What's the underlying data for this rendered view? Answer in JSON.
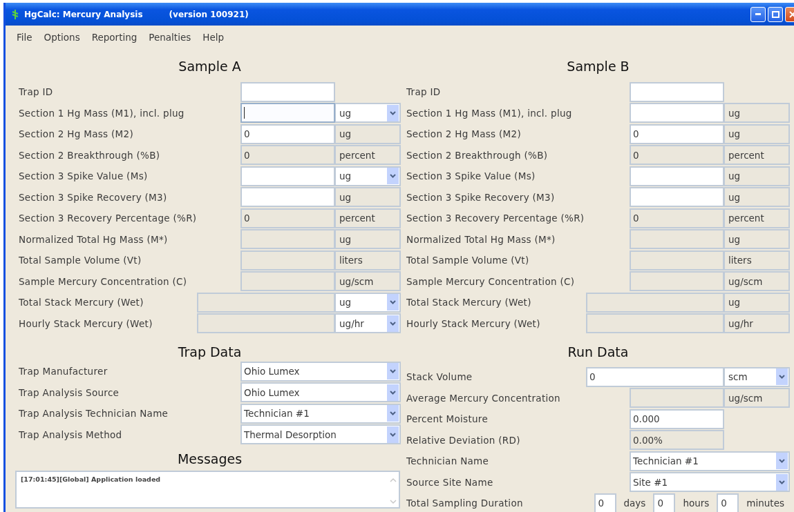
{
  "window": {
    "title": "HgCalc: Mercury Analysis",
    "version": "(version 100921)"
  },
  "menu": [
    "File",
    "Options",
    "Reporting",
    "Penalties",
    "Help"
  ],
  "samples": [
    {
      "heading": "Sample A",
      "rows": [
        {
          "kind": "normal",
          "label": "Trap ID",
          "editable": true,
          "focused": false
        },
        {
          "kind": "normal",
          "label": "Section 1 Hg Mass (M1), incl. plug",
          "editable": true,
          "focused": true,
          "unit": {
            "text": "ug",
            "dropdown": true
          }
        },
        {
          "kind": "normal",
          "label": "Section 2 Hg Mass (M2)",
          "value": "0",
          "editable": true,
          "focused": false,
          "unit": {
            "text": "ug",
            "dropdown": false
          }
        },
        {
          "kind": "normal",
          "label": "Section 2 Breakthrough (%B)",
          "value": "0",
          "editable": false,
          "focused": false,
          "unit": {
            "text": "percent",
            "dropdown": false
          }
        },
        {
          "kind": "normal",
          "label": "Section 3 Spike Value (Ms)",
          "editable": true,
          "focused": false,
          "unit": {
            "text": "ug",
            "dropdown": true
          }
        },
        {
          "kind": "normal",
          "label": "Section 3 Spike Recovery (M3)",
          "editable": true,
          "focused": false,
          "unit": {
            "text": "ug",
            "dropdown": false
          }
        },
        {
          "kind": "normal",
          "label": "Section 3 Recovery Percentage (%R)",
          "value": "0",
          "editable": false,
          "focused": false,
          "unit": {
            "text": "percent",
            "dropdown": false
          }
        },
        {
          "kind": "normal",
          "label": "Normalized Total Hg Mass (M*)",
          "editable": false,
          "focused": false,
          "unit": {
            "text": "ug",
            "dropdown": false
          }
        },
        {
          "kind": "normal",
          "label": "Total Sample Volume (Vt)",
          "editable": false,
          "focused": false,
          "unit": {
            "text": "liters",
            "dropdown": false
          }
        },
        {
          "kind": "normal",
          "label": "Sample Mercury Concentration (C)",
          "editable": false,
          "focused": false,
          "unit": {
            "text": "ug/scm",
            "dropdown": false
          }
        },
        {
          "kind": "wide",
          "label": "Total Stack Mercury (Wet)",
          "editable": false,
          "focused": false,
          "unit": {
            "text": "ug",
            "dropdown": true
          }
        },
        {
          "kind": "wide",
          "label": "Hourly Stack Mercury (Wet)",
          "editable": false,
          "focused": false,
          "unit": {
            "text": "ug/hr",
            "dropdown": true
          }
        }
      ]
    },
    {
      "heading": "Sample B",
      "rows": [
        {
          "kind": "normal",
          "label": "Trap ID",
          "editable": true,
          "focused": false
        },
        {
          "kind": "normal",
          "label": "Section 1 Hg Mass (M1), incl. plug",
          "editable": true,
          "focused": false,
          "unit": {
            "text": "ug",
            "dropdown": false
          }
        },
        {
          "kind": "normal",
          "label": "Section 2 Hg Mass (M2)",
          "value": "0",
          "editable": true,
          "focused": false,
          "unit": {
            "text": "ug",
            "dropdown": false
          }
        },
        {
          "kind": "normal",
          "label": "Section 2 Breakthrough (%B)",
          "value": "0",
          "editable": false,
          "focused": false,
          "unit": {
            "text": "percent",
            "dropdown": false
          }
        },
        {
          "kind": "normal",
          "label": "Section 3 Spike Value (Ms)",
          "editable": true,
          "focused": false,
          "unit": {
            "text": "ug",
            "dropdown": false
          }
        },
        {
          "kind": "normal",
          "label": "Section 3 Spike Recovery (M3)",
          "editable": true,
          "focused": false,
          "unit": {
            "text": "ug",
            "dropdown": false
          }
        },
        {
          "kind": "normal",
          "label": "Section 3 Recovery Percentage (%R)",
          "value": "0",
          "editable": false,
          "focused": false,
          "unit": {
            "text": "percent",
            "dropdown": false
          }
        },
        {
          "kind": "normal",
          "label": "Normalized Total Hg Mass (M*)",
          "editable": false,
          "focused": false,
          "unit": {
            "text": "ug",
            "dropdown": false
          }
        },
        {
          "kind": "normal",
          "label": "Total Sample Volume (Vt)",
          "editable": false,
          "focused": false,
          "unit": {
            "text": "liters",
            "dropdown": false
          }
        },
        {
          "kind": "normal",
          "label": "Sample Mercury Concentration (C)",
          "editable": false,
          "focused": false,
          "unit": {
            "text": "ug/scm",
            "dropdown": false
          }
        },
        {
          "kind": "wide",
          "label": "Total Stack Mercury (Wet)",
          "editable": false,
          "focused": false,
          "unit": {
            "text": "ug",
            "dropdown": false
          }
        },
        {
          "kind": "wide",
          "label": "Hourly Stack Mercury (Wet)",
          "editable": false,
          "focused": false,
          "unit": {
            "text": "ug/hr",
            "dropdown": false
          }
        }
      ]
    }
  ],
  "trap_data": {
    "heading": "Trap Data",
    "rows": [
      {
        "kind": "select",
        "label": "Trap Manufacturer",
        "value": "Ohio Lumex"
      },
      {
        "kind": "select",
        "label": "Trap Analysis Source",
        "value": "Ohio Lumex"
      },
      {
        "kind": "select",
        "label": "Trap Analysis Technician Name",
        "value": "Technician #1"
      },
      {
        "kind": "select",
        "label": "Trap Analysis Method",
        "value": "Thermal Desorption"
      }
    ]
  },
  "run_data": {
    "heading": "Run Data",
    "rows": [
      {
        "kind": "wide",
        "label": "Stack Volume",
        "value": "0",
        "editable": true,
        "focused": false,
        "unit": {
          "text": "scm",
          "dropdown": true
        }
      },
      {
        "kind": "normal",
        "label": "Average Mercury Concentration",
        "editable": false,
        "focused": false,
        "unit": {
          "text": "ug/scm",
          "dropdown": false
        }
      },
      {
        "kind": "normal",
        "label": "Percent Moisture",
        "value": "0.000",
        "editable": true,
        "focused": false
      },
      {
        "kind": "normal",
        "label": "Relative Deviation (RD)",
        "value": "0.00%",
        "editable": false,
        "focused": false
      },
      {
        "kind": "select",
        "label": "Technician Name",
        "value": "Technician #1"
      },
      {
        "kind": "select",
        "label": "Source Site Name",
        "value": "Site #1"
      },
      {
        "kind": "duration",
        "label": "Total Sampling Duration",
        "parts": [
          {
            "value": "0",
            "unit": "days"
          },
          {
            "value": "0",
            "unit": "hours"
          },
          {
            "value": "0",
            "unit": "minutes"
          }
        ]
      }
    ]
  },
  "messages": {
    "heading": "Messages",
    "lines": [
      "[17:01:45][Global] Application loaded"
    ]
  }
}
